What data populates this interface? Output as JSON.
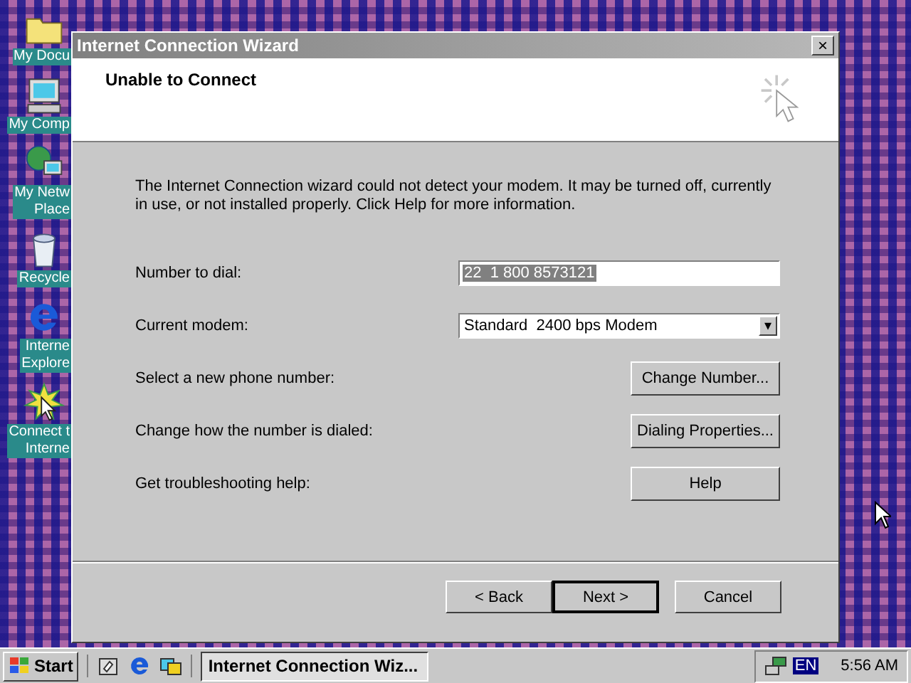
{
  "desktop_icons": [
    {
      "kind": "folder",
      "lines": [
        "My Docu"
      ]
    },
    {
      "kind": "computer",
      "lines": [
        "My Comp"
      ]
    },
    {
      "kind": "network",
      "lines": [
        "My Netw",
        "Place"
      ]
    },
    {
      "kind": "recycle",
      "lines": [
        "Recycle"
      ]
    },
    {
      "kind": "browser",
      "lines": [
        "Interne",
        "Explore"
      ]
    },
    {
      "kind": "connect",
      "lines": [
        "Connect t",
        "Interne"
      ]
    }
  ],
  "window": {
    "title": "Internet Connection Wizard",
    "close": "×"
  },
  "header": {
    "title": "Unable to Connect"
  },
  "message": "The Internet Connection wizard could not detect your modem. It may be turned off, currently in use, or not installed properly. Click Help for more information.",
  "rows": [
    {
      "kind": "input",
      "label": "Number to dial:",
      "value": "22  1 800 8573121",
      "selected": true
    },
    {
      "kind": "dropdown",
      "label": "Current modem:",
      "value": "Standard  2400 bps Modem",
      "arrow": "▾"
    },
    {
      "kind": "button",
      "label": "Select a new phone number:",
      "button": "Change Number..."
    },
    {
      "kind": "button",
      "label": "Change how the number is dialed:",
      "button": "Dialing Properties..."
    },
    {
      "kind": "button",
      "label": "Get troubleshooting help:",
      "button": "Help"
    }
  ],
  "nav_buttons": [
    {
      "label": "< Back",
      "default": false
    },
    {
      "label": "Next >",
      "default": true
    },
    {
      "label": "Cancel",
      "default": false
    }
  ],
  "taskbar": {
    "start": "Start",
    "task": "Internet Connection Wiz...",
    "language": "EN",
    "clock": "5:56 AM"
  }
}
